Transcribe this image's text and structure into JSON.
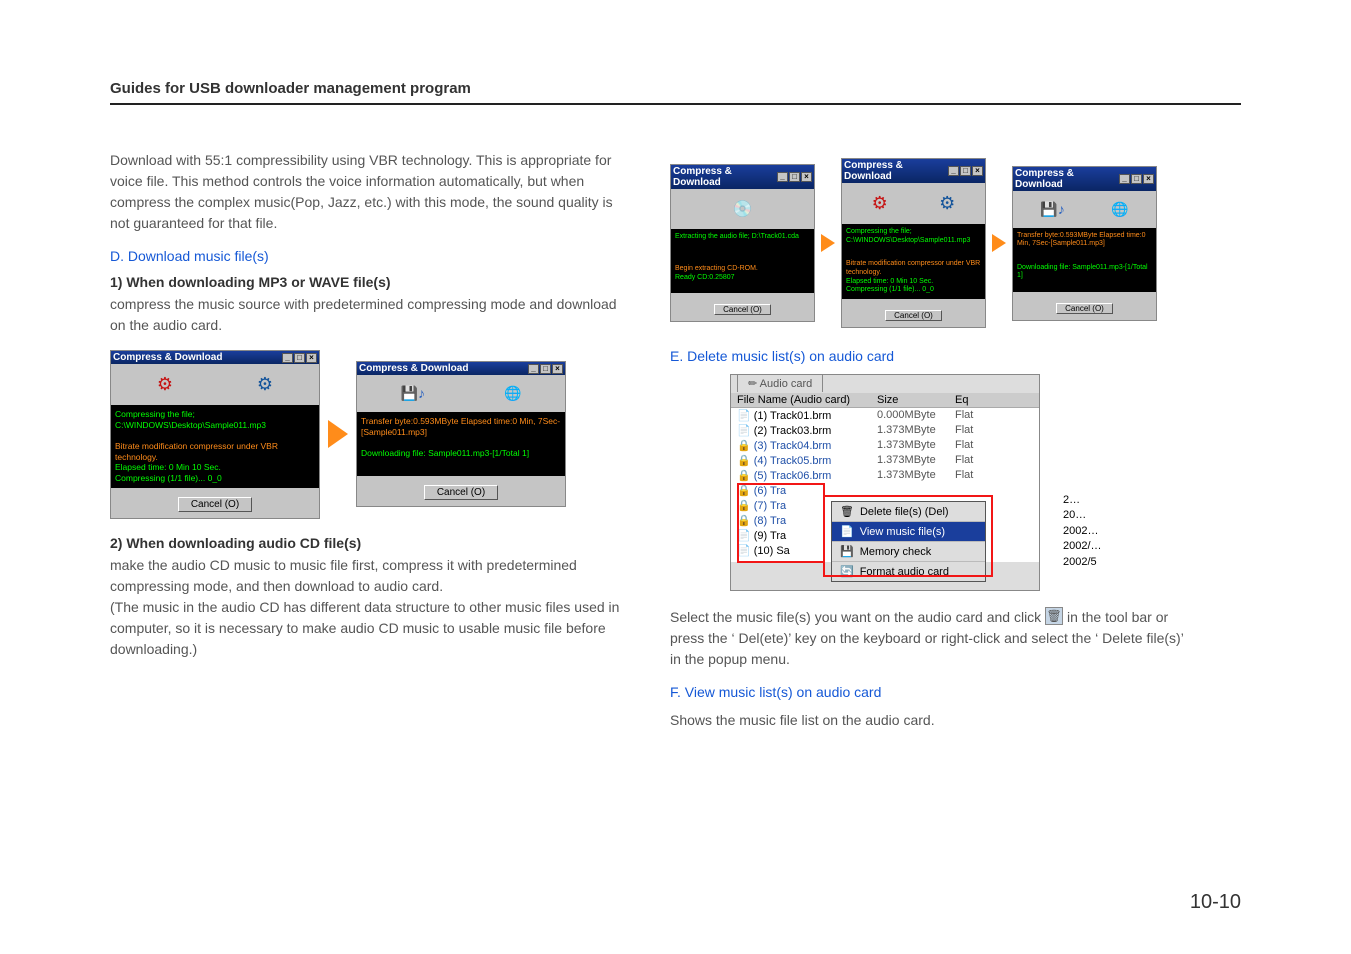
{
  "header": {
    "title": "Guides for USB downloader management program"
  },
  "left": {
    "intro": "Download with 55:1 compressibility using VBR technology. This is appropriate for voice file. This method controls the voice information automatically, but when compress the complex music(Pop, Jazz, etc.) with this mode, the sound quality is not guaranteed for that file.",
    "d_title": "D.  Download music file(s)",
    "d1_title": "1)  When downloading MP3 or WAVE file(s)",
    "d1_body": "compress the music source with predetermined compressing mode and  download on the audio card.",
    "d2_title": "2)  When downloading audio CD file(s)",
    "d2_body": "make the audio CD music to music file first, compress it with predetermined compressing mode, and then download to audio card.\n(The music in the audio CD has different data structure to other music files used in computer, so it is necessary to make audio CD music to usable music file before downloading.)"
  },
  "right": {
    "e_title": "E. Delete music list(s) on audio card",
    "e_body_1": "Select the music file(s) you want on the audio card  and click ",
    "e_body_2": " in the tool bar or press the ‘ Del(ete)’  key on the keyboard  or right-click and select the ‘ Delete file(s)’  in the popup menu.",
    "f_title": "F. View music list(s) on audio card",
    "f_body": "Shows the music file list on the audio card."
  },
  "dialogs": {
    "title": "Compress & Download",
    "cancel": "Cancel (O)",
    "d1a_line1": "Compressing the file;",
    "d1a_line2": "C:\\WINDOWS\\Desktop\\Sample011.mp3",
    "d1a_line3": "Bitrate modification compressor under VBR technology.",
    "d1a_line4": "Elapsed time: 0 Min 10 Sec.",
    "d1a_line5": "Compressing (1/1 file)... 0_0",
    "d1b_line1": "Transfer byte:0.593MByte Elapsed time:0 Min, 7Sec-[Sample011.mp3]",
    "d1b_line2": "Downloading file: Sample011.mp3-[1/Total 1]",
    "d2a_line1": "Extracting the audio file; D:\\Track01.cda",
    "d2a_line2": "Begin extracting CD-ROM.",
    "d2a_line3": "Ready CD:0.25807",
    "d2b_line1": "Compressing the file;",
    "d2b_line2": "C:\\WINDOWS\\Desktop\\Sample011.mp3",
    "d2b_line3": "Bitrate modification compressor under VBR technology.",
    "d2b_line4": "Elapsed time: 0 Min 10 Sec.",
    "d2b_line5": "Compressing (1/1 file)... 0_0",
    "d2c_line1": "Transfer byte:0.593MByte Elapsed time:0 Min, 7Sec-[Sample011.mp3]",
    "d2c_line2": "Downloading file: Sample011.mp3-[1/Total 1]"
  },
  "audio": {
    "tab": "Audio card",
    "col1": "File Name (Audio card)",
    "col2": "Size",
    "col3": "Eq",
    "rows": [
      {
        "n": "(1) Track01.brm",
        "s": "0.000MByte",
        "e": "Flat",
        "locked": false
      },
      {
        "n": "(2) Track03.brm",
        "s": "1.373MByte",
        "e": "Flat",
        "locked": false
      },
      {
        "n": "(3) Track04.brm",
        "s": "1.373MByte",
        "e": "Flat",
        "locked": true
      },
      {
        "n": "(4) Track05.brm",
        "s": "1.373MByte",
        "e": "Flat",
        "locked": true
      },
      {
        "n": "(5) Track06.brm",
        "s": "1.373MByte",
        "e": "Flat",
        "locked": true
      },
      {
        "n": "(6) Tra",
        "s": "",
        "e": "",
        "locked": true
      },
      {
        "n": "(7) Tra",
        "s": "",
        "e": "",
        "locked": true
      },
      {
        "n": "(8) Tra",
        "s": "",
        "e": "",
        "locked": true
      },
      {
        "n": "(9) Tra",
        "s": "",
        "e": "",
        "locked": false
      },
      {
        "n": "(10) Sa",
        "s": "",
        "e": "",
        "locked": false
      }
    ],
    "side_dates": [
      "2…",
      "20…",
      "2002…",
      "2002/…",
      "2002/5"
    ],
    "ctx": {
      "del": "Delete file(s)    (Del)",
      "view": "View music file(s)",
      "mem": "Memory check",
      "fmt": "Format audio card"
    }
  },
  "page_number": "10-10"
}
